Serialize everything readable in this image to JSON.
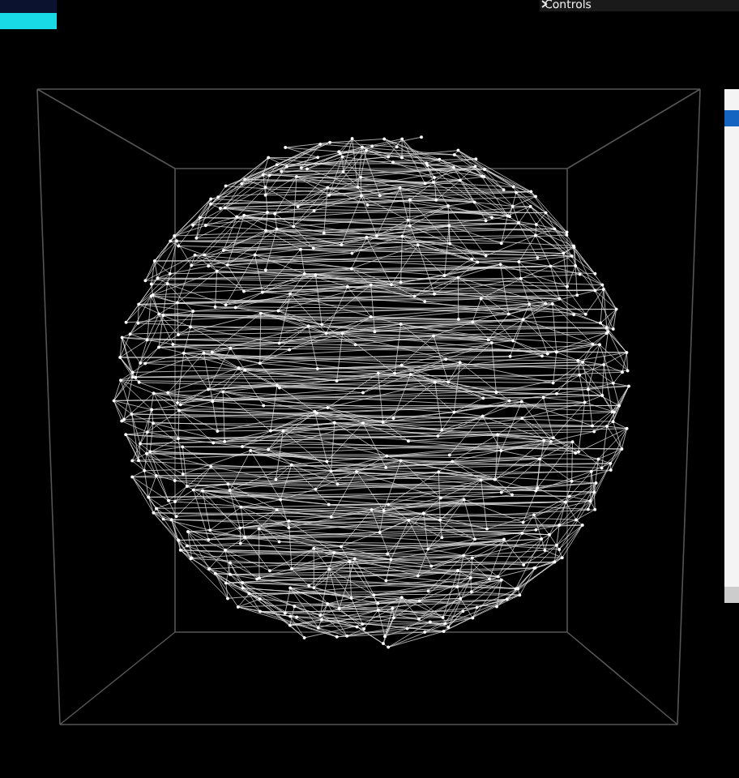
{
  "controls_panel": {
    "label": "Controls",
    "expanded": false
  }
}
